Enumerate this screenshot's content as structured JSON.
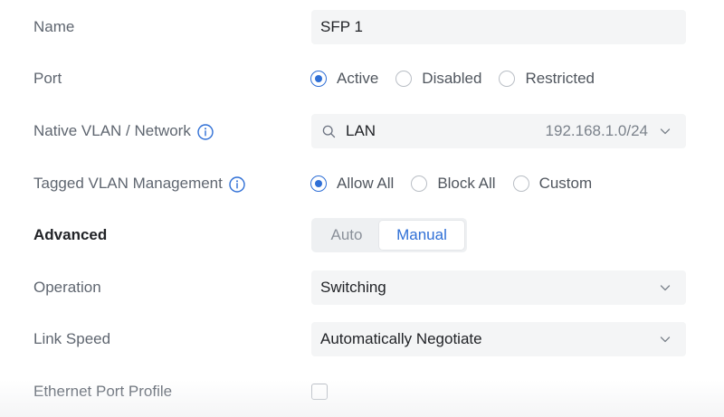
{
  "rows": {
    "name": {
      "label": "Name",
      "value": "SFP 1"
    },
    "port": {
      "label": "Port",
      "options": [
        "Active",
        "Disabled",
        "Restricted"
      ],
      "selected": "Active"
    },
    "native_vlan": {
      "label": "Native VLAN / Network",
      "value": "LAN",
      "subnet": "192.168.1.0/24",
      "icon": "search-icon"
    },
    "tagged_vlan": {
      "label": "Tagged VLAN Management",
      "options": [
        "Allow All",
        "Block All",
        "Custom"
      ],
      "selected": "Allow All"
    },
    "advanced": {
      "label": "Advanced",
      "options": [
        "Auto",
        "Manual"
      ],
      "selected": "Manual"
    },
    "operation": {
      "label": "Operation",
      "value": "Switching"
    },
    "link_speed": {
      "label": "Link Speed",
      "value": "Automatically Negotiate"
    },
    "ethernet_port_profile": {
      "label": "Ethernet Port Profile",
      "checked": false
    }
  },
  "colors": {
    "accent": "#2f6fd6",
    "field_bg": "#f4f5f6",
    "label_text": "#5f6670"
  }
}
